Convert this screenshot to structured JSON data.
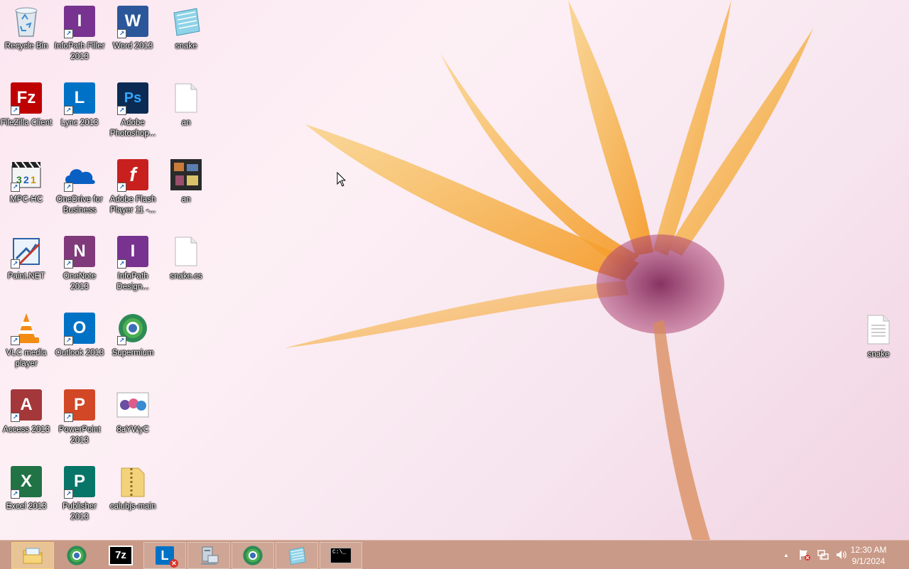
{
  "desktop_icons": [
    {
      "label": "Recycle Bin",
      "icon": "recycle-bin-icon"
    },
    {
      "label": "InfoPath Filler 2013",
      "icon": "infopath-icon"
    },
    {
      "label": "Word 2013",
      "icon": "word-icon"
    },
    {
      "label": "snake",
      "icon": "notepad-icon"
    },
    {
      "label": "FileZilla Client",
      "icon": "filezilla-icon"
    },
    {
      "label": "Lync 2013",
      "icon": "lync-icon"
    },
    {
      "label": "Adobe Photoshop...",
      "icon": "photoshop-icon"
    },
    {
      "label": "an",
      "icon": "blank-file-icon"
    },
    {
      "label": "MPC-HC",
      "icon": "mpc-hc-icon"
    },
    {
      "label": "OneDrive for Business",
      "icon": "onedrive-icon"
    },
    {
      "label": "Adobe Flash Player 11 -...",
      "icon": "flash-icon"
    },
    {
      "label": "an",
      "icon": "image-file-icon"
    },
    {
      "label": "Paint.NET",
      "icon": "paintnet-icon"
    },
    {
      "label": "OneNote 2013",
      "icon": "onenote-icon"
    },
    {
      "label": "InfoPath Design...",
      "icon": "infopath-designer-icon"
    },
    {
      "label": "snake.cs",
      "icon": "blank-file-icon"
    },
    {
      "label": "VLC media player",
      "icon": "vlc-icon"
    },
    {
      "label": "Outlook 2013",
      "icon": "outlook-icon"
    },
    {
      "label": "Supermium",
      "icon": "supermium-icon"
    },
    {
      "label": "Access 2013",
      "icon": "access-icon"
    },
    {
      "label": "PowerPoint 2013",
      "icon": "powerpoint-icon"
    },
    {
      "label": "8aYWyC",
      "icon": "image-file-icon"
    },
    {
      "label": "Excel 2013",
      "icon": "excel-icon"
    },
    {
      "label": "Publisher 2013",
      "icon": "publisher-icon"
    },
    {
      "label": "calubjs-main",
      "icon": "zip-folder-icon"
    },
    {
      "label": "snake",
      "icon": "text-file-icon"
    }
  ],
  "taskbar": {
    "buttons": [
      {
        "name": "file-explorer",
        "icon": "folder-icon",
        "active": true
      },
      {
        "name": "supermium",
        "icon": "supermium-icon",
        "active": false
      },
      {
        "name": "7zip",
        "icon": "7zip-icon",
        "label": "7z",
        "active": false
      },
      {
        "name": "lync",
        "icon": "lync-icon",
        "label": "L",
        "active": false
      },
      {
        "name": "computer",
        "icon": "computer-icon",
        "active": false
      },
      {
        "name": "supermium-2",
        "icon": "supermium-icon",
        "active": false
      },
      {
        "name": "notepad",
        "icon": "notepad-icon",
        "active": false
      },
      {
        "name": "command-prompt",
        "icon": "cmd-icon",
        "label": "C:\\_",
        "active": false
      }
    ],
    "tray": {
      "show_hidden": "▲",
      "time": "12:30 AM",
      "date": "9/1/2024"
    }
  },
  "colors": {
    "taskbar": "#c99a87",
    "word": "#2b579a",
    "excel": "#217346",
    "powerpoint": "#d24726",
    "access": "#a4373a",
    "onenote": "#80397b",
    "infopath": "#77338f",
    "outlook": "#0072c6",
    "publisher": "#077568",
    "lync": "#0072c6",
    "filezilla": "#bf0000",
    "photoshop": "#0b2b54",
    "flash": "#c8201f"
  }
}
